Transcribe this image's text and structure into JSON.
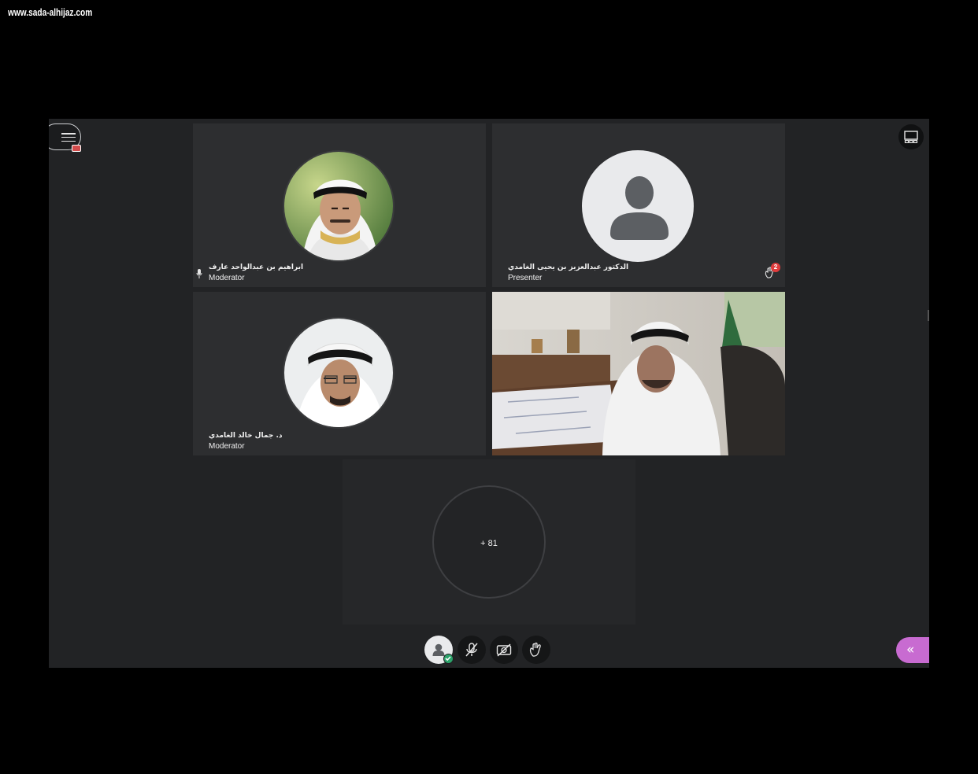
{
  "watermark": "www.sada-alhijaz.com",
  "tiles": [
    {
      "name": "ابراهيم بن عبدالواحد عارف",
      "role": "Moderator"
    },
    {
      "name": "الدكتور عبدالعزيز بن يحيى الغامدي",
      "role": "Presenter",
      "hand_badge": "2"
    },
    {
      "name": "د. جمال خالد الغامدي",
      "role": "Moderator"
    }
  ],
  "overflow": {
    "count_label": "+ 81"
  },
  "icons": {
    "menu": "hamburger-menu-icon",
    "recording": "recording-icon",
    "layout": "layout-icon",
    "mic": "microphone-icon",
    "raise_hand": "raise-hand-icon",
    "mic_off": "microphone-off-icon",
    "camera_off": "camera-off-icon",
    "avatar": "user-avatar-icon",
    "status_check": "check-icon",
    "collapse": "chevron-double-left-icon"
  },
  "colors": {
    "app_background": "#222325",
    "tile_background": "#2d2e30",
    "badge": "#e03c3c",
    "status_ok": "#2ca36b",
    "collapse_accent": "#c86bd1"
  }
}
